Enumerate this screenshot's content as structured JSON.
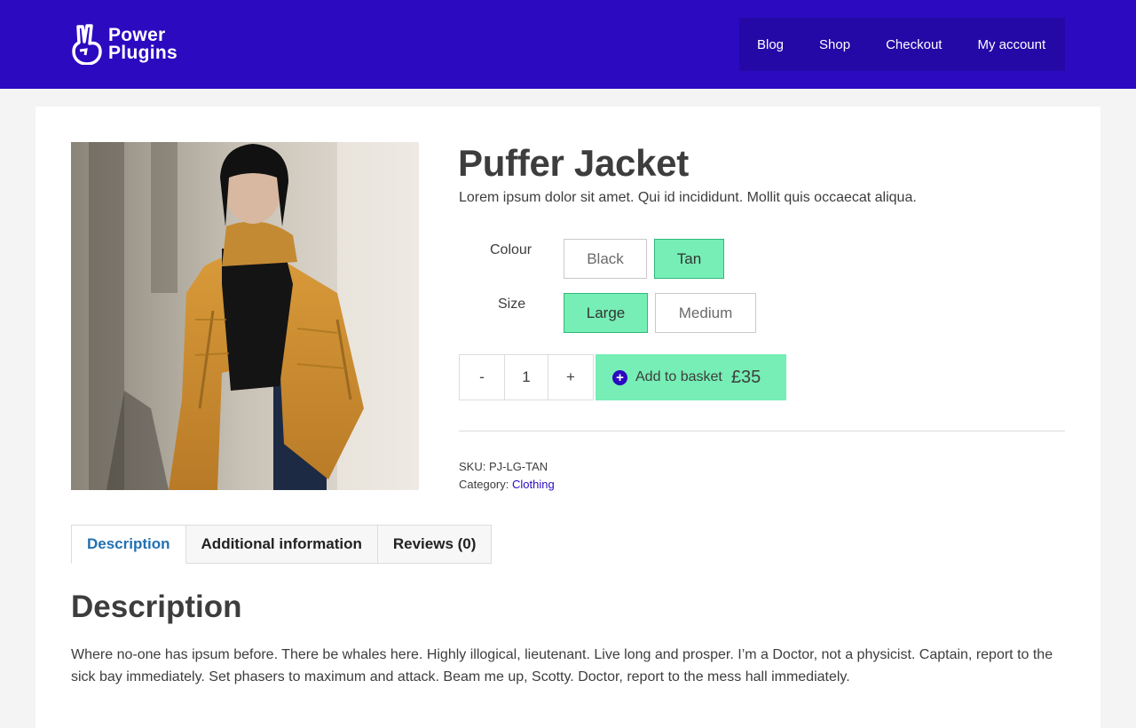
{
  "header": {
    "logo_line1": "Power",
    "logo_line2": "Plugins",
    "nav": [
      "Blog",
      "Shop",
      "Checkout",
      "My account"
    ]
  },
  "product": {
    "title": "Puffer Jacket",
    "summary": "Lorem ipsum dolor sit amet. Qui id incididunt. Mollit quis occaecat aliqua.",
    "colour_label": "Colour",
    "colour_options": [
      "Black",
      "Tan"
    ],
    "colour_selected": "Tan",
    "size_label": "Size",
    "size_options": [
      "Large",
      "Medium"
    ],
    "size_selected": "Large",
    "qty_minus": "-",
    "quantity": "1",
    "qty_plus": "+",
    "add_to_basket": "Add to basket",
    "price": "£35",
    "sku_label": "SKU:",
    "sku": "PJ-LG-TAN",
    "category_label": "Category:",
    "category": "Clothing"
  },
  "tabs": [
    "Description",
    "Additional information",
    "Reviews (0)"
  ],
  "description": {
    "heading": "Description",
    "body": "Where no-one has ipsum before. There be whales here. Highly illogical, lieutenant. Live long and prosper. I’m a Doctor, not a physicist. Captain, report to the sick bay immediately. Set phasers to maximum and attack. Beam me up, Scotty. Doctor, report to the mess hall immediately."
  },
  "colors": {
    "brand": "#2b0ac0",
    "accent": "#76eeb5",
    "link": "#2271b1"
  },
  "icons": {
    "logo": "peace-hand-icon",
    "add": "plus-circle-icon"
  }
}
